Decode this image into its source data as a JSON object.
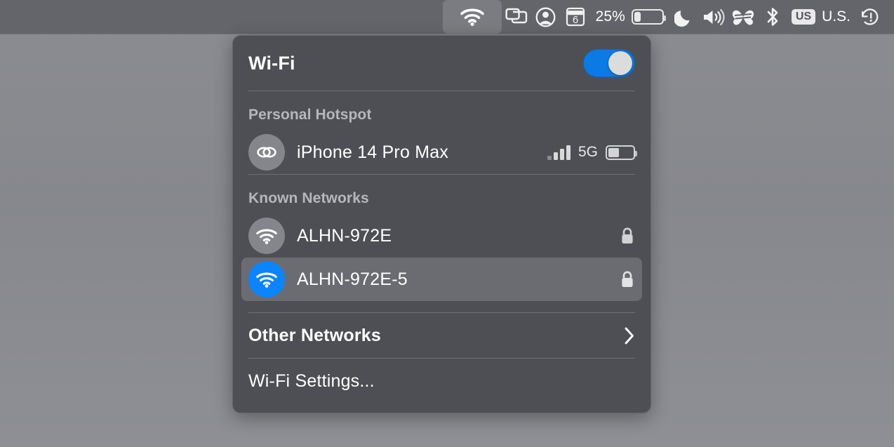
{
  "menubar": {
    "items": [
      {
        "name": "wifi-icon",
        "label": "",
        "icon": "wifi-icon",
        "active": true
      },
      {
        "name": "screen-mirroring-icon",
        "label": "",
        "icon": "screen-mirroring-icon"
      },
      {
        "name": "user-account-icon",
        "label": "",
        "icon": "user-account-icon"
      },
      {
        "name": "calendar-icon",
        "label": "6",
        "icon": "calendar-icon"
      }
    ],
    "battery": {
      "percent_label": "25%",
      "fill_percent": 25
    },
    "do_not_disturb_icon": "moon-icon",
    "volume_icon": "speaker-icon",
    "butterfly_icon": "butterfly-icon",
    "bluetooth_icon": "bluetooth-icon",
    "keyboard": {
      "badge": "US",
      "label": "U.S."
    },
    "update_alert_icon": "update-alert-icon"
  },
  "panel": {
    "title": "Wi-Fi",
    "wifi_enabled": true,
    "sections": {
      "personal_hotspot": {
        "label": "Personal Hotspot",
        "device": {
          "name": "iPhone 14 Pro Max",
          "icon": "hotspot-link-icon",
          "signal_bars": 4,
          "signal_active": 3,
          "network_type": "5G",
          "battery_fill_percent": 45
        }
      },
      "known_networks": {
        "label": "Known Networks",
        "networks": [
          {
            "ssid": "ALHN-972E",
            "connected": false,
            "secured": true,
            "icon": "wifi-icon",
            "lock_icon": "lock-icon"
          },
          {
            "ssid": "ALHN-972E-5",
            "connected": true,
            "secured": true,
            "icon": "wifi-icon",
            "lock_icon": "lock-icon"
          }
        ]
      }
    },
    "other_networks": {
      "label": "Other Networks",
      "chevron_icon": "chevron-right-icon"
    },
    "settings": {
      "label": "Wi-Fi Settings..."
    }
  },
  "colors": {
    "accent_blue": "#0a84ff",
    "toggle_blue": "#0b7ae5",
    "menubar_bg": "#64656a",
    "panel_bg": "#4e4f54",
    "selected_row": "#6b6c71",
    "desktop_bg": "#8b8c91"
  }
}
